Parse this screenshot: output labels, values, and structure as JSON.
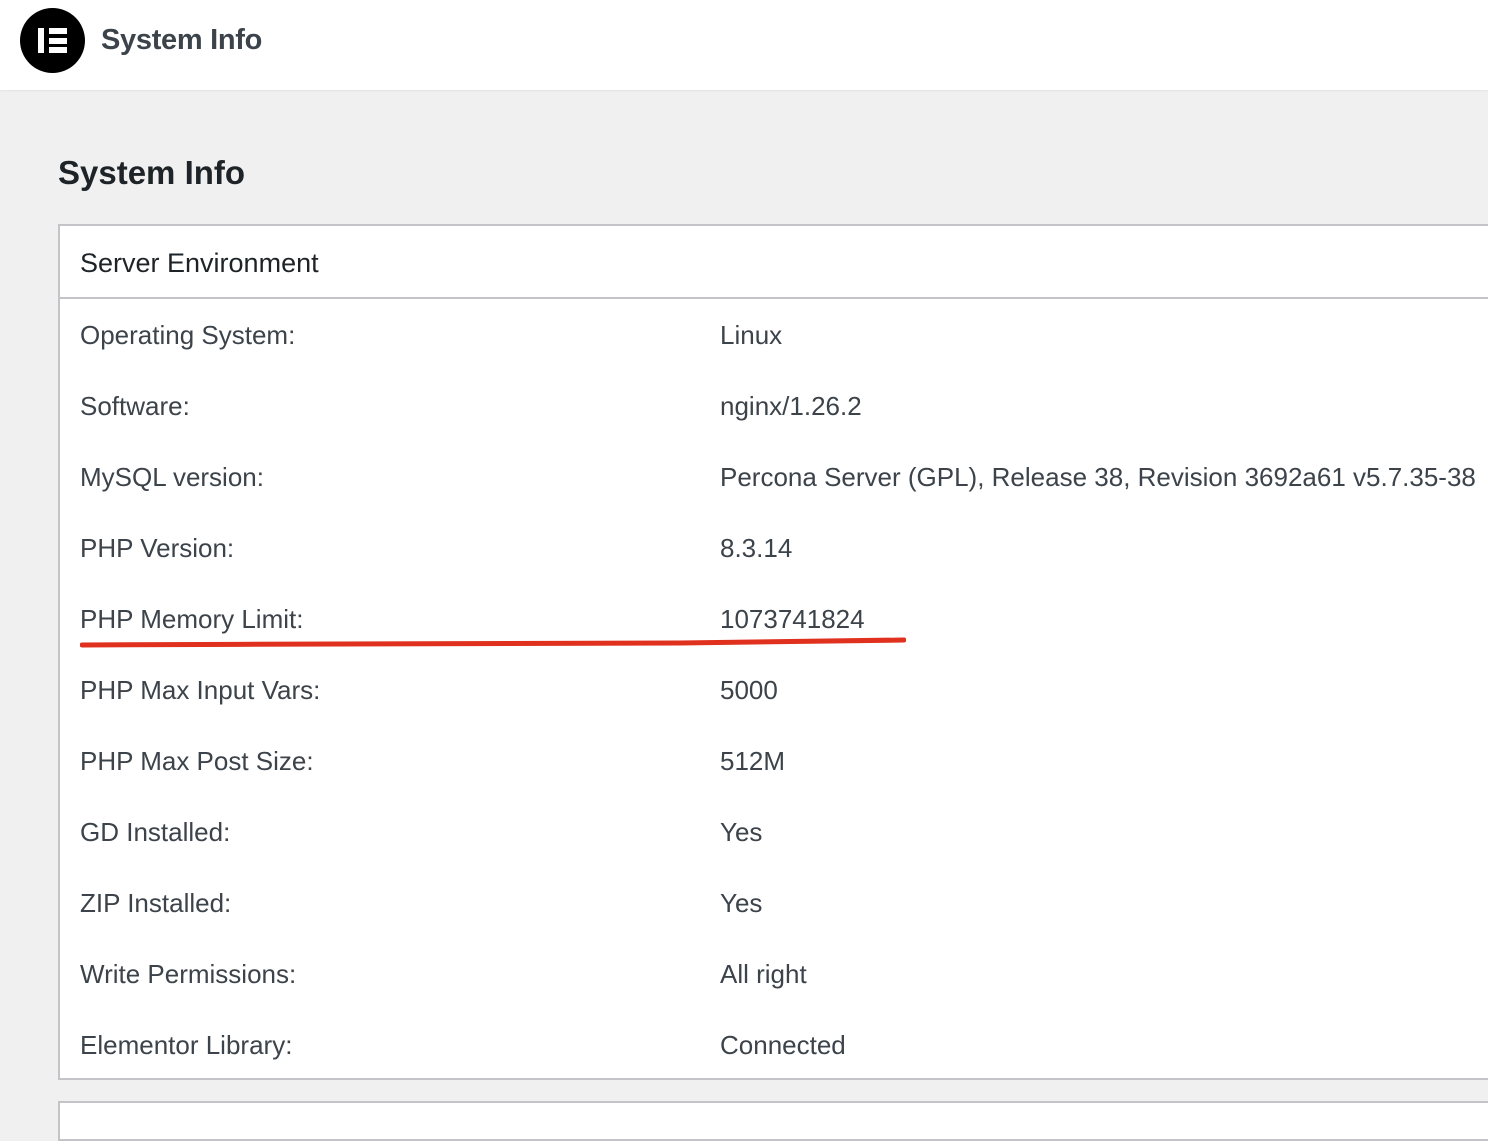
{
  "header": {
    "logo_icon": "elementor-logo-icon",
    "title": "System Info"
  },
  "page": {
    "title": "System Info"
  },
  "server_environment": {
    "heading": "Server Environment",
    "rows": [
      {
        "label": "Operating System:",
        "value": "Linux"
      },
      {
        "label": "Software:",
        "value": "nginx/1.26.2"
      },
      {
        "label": "MySQL version:",
        "value": "Percona Server (GPL), Release 38, Revision 3692a61 v5.7.35-38"
      },
      {
        "label": "PHP Version:",
        "value": "8.3.14"
      },
      {
        "label": "PHP Memory Limit:",
        "value": "1073741824"
      },
      {
        "label": "PHP Max Input Vars:",
        "value": "5000"
      },
      {
        "label": "PHP Max Post Size:",
        "value": "512M"
      },
      {
        "label": "GD Installed:",
        "value": "Yes"
      },
      {
        "label": "ZIP Installed:",
        "value": "Yes"
      },
      {
        "label": "Write Permissions:",
        "value": "All right"
      },
      {
        "label": "Elementor Library:",
        "value": "Connected"
      }
    ]
  },
  "annotation": {
    "highlighted_row": "PHP Memory Limit:",
    "color": "#e0301e"
  },
  "colors": {
    "background": "#f0f0f1",
    "panel": "#ffffff",
    "border": "#c3c4c7",
    "text": "#3c434a",
    "heading": "#1d2327"
  }
}
